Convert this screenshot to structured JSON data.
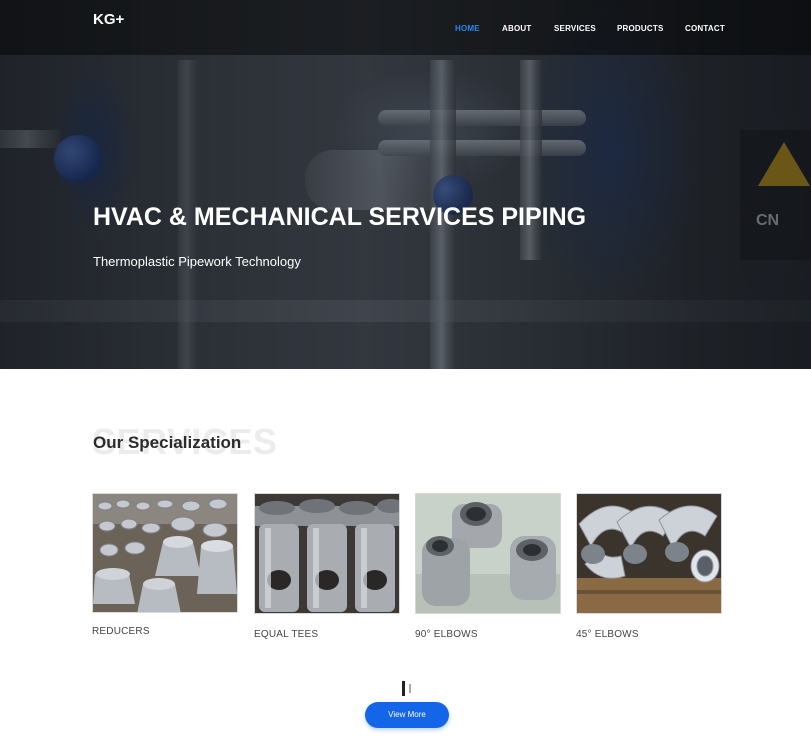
{
  "nav": {
    "brand": "KG+",
    "items": [
      {
        "label": "HOME",
        "active": true
      },
      {
        "label": "ABOUT",
        "active": false
      },
      {
        "label": "SERVICES",
        "active": false
      },
      {
        "label": "PRODUCTS",
        "active": false
      },
      {
        "label": "CONTACT",
        "active": false
      }
    ]
  },
  "hero": {
    "title": "HVAC & MECHANICAL SERVICES PIPING",
    "subtitle": "Thermoplastic Pipework Technology",
    "sign_text": "CN"
  },
  "specialization": {
    "background_word": "SERVICES",
    "title": "Our Specialization",
    "items": [
      {
        "label": "REDUCERS"
      },
      {
        "label": "EQUAL TEES"
      },
      {
        "label": "90° ELBOWS"
      },
      {
        "label": "45° ELBOWS"
      }
    ]
  },
  "carousel": {
    "pages": 2,
    "current": 1
  },
  "cta": {
    "label": "View More"
  },
  "colors": {
    "accent": "#1565e8",
    "nav_active": "#2e86f0"
  }
}
